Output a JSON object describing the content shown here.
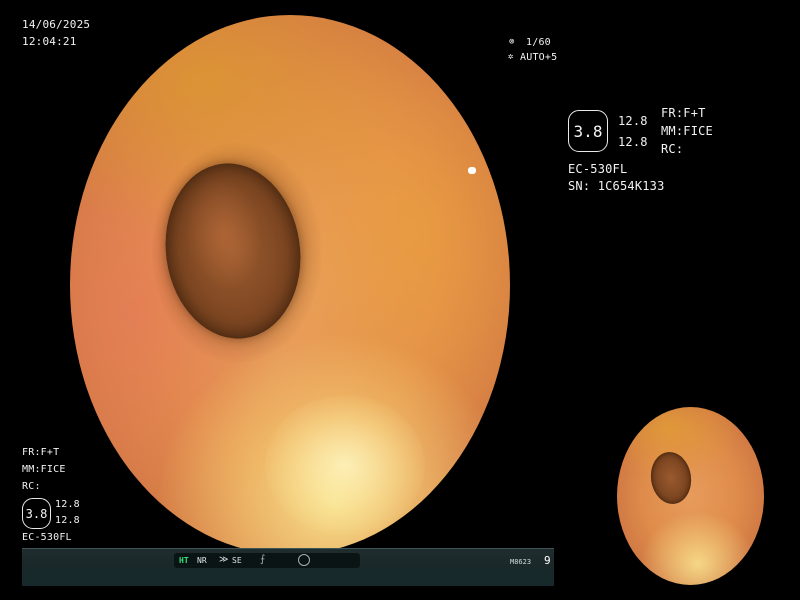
{
  "datetime": {
    "date": "14/06/2025",
    "time": "12:04:21"
  },
  "exposure": {
    "shutter": "1/60",
    "auto": "AUTO+5",
    "shutter_icon": "shutter-icon",
    "auto_icon": "iris-icon"
  },
  "scope_info": {
    "badge_value": "3.8",
    "value_top": "12.8",
    "value_bottom": "12.8",
    "model": "EC-530FL",
    "serial": "SN: 1C654K133"
  },
  "modes": {
    "fr": "FR:F+T",
    "mm": "MM:FICE",
    "rc": "RC:"
  },
  "bottom_left": {
    "fr": "FR:F+T",
    "mm": "MM:FICE",
    "rc": "RC:",
    "badge_value": "3.8",
    "value_top": "12.8",
    "value_bottom": "12.8",
    "model": "EC-530FL"
  },
  "status_bar": {
    "ht": "HT",
    "nr": "NR",
    "se": "SE",
    "se_icon": "enhance-icon",
    "edge_icon": "edge-icon",
    "circle_icon": "circle-icon",
    "code": "M8623",
    "number": "9"
  },
  "colors": {
    "ht_indicator": "#35e07a",
    "background": "#000000"
  }
}
